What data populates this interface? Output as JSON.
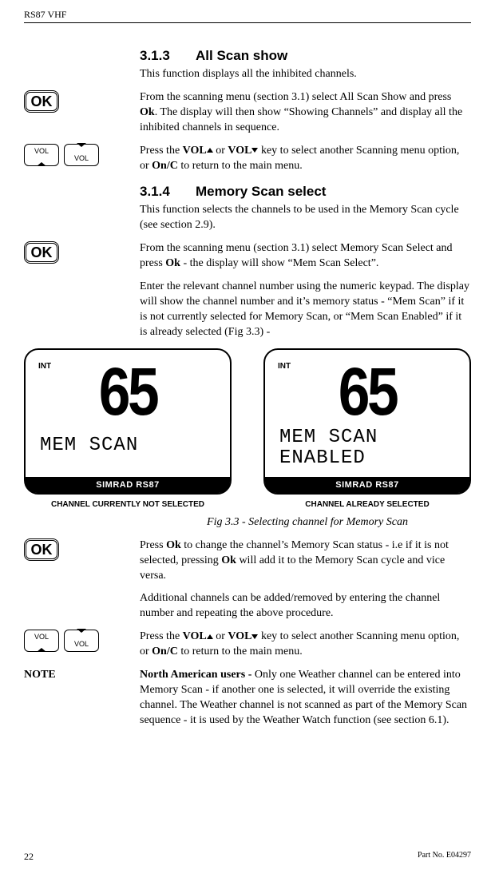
{
  "header": {
    "title": "RS87 VHF"
  },
  "s313": {
    "num": "3.1.3",
    "title": "All Scan show",
    "intro": "This function displays all the inhibited channels.",
    "p1a": "From the scanning menu (section 3.1) select All Scan Show and press ",
    "p1b": ".  The display will then show “Showing Channels” and display all the inhibited channels in sequence.",
    "ok": "Ok",
    "p2a": "Press the ",
    "vol": "VOL",
    "p2b": " or ",
    "p2c": " key to select another Scanning menu option, or ",
    "onc": "On/C",
    "p2d": " to return to the main menu."
  },
  "s314": {
    "num": "3.1.4",
    "title": "Memory Scan select",
    "intro": "This function selects the channels to be used in the Memory Scan cycle (see section 2.9).",
    "p1a": "From the scanning menu (section 3.1) select Memory Scan Select and press ",
    "ok": "Ok",
    "p1b": " - the display will show “Mem Scan Select”.",
    "p2": "Enter the relevant channel number using the numeric keypad.  The display will show the channel number and it’s memory status - “Mem Scan” if it is not currently selected for Memory Scan, or “Mem Scan Enabled” if it is already selected (Fig 3.3) -"
  },
  "lcd": {
    "int": "INT",
    "channel": "65",
    "line1": "MEM SCAN",
    "line2": "ENABLED",
    "brand": "SIMRAD RS87",
    "cap1": "CHANNEL CURRENTLY NOT SELECTED",
    "cap2": "CHANNEL ALREADY SELECTED"
  },
  "fig": "Fig 3.3 - Selecting channel for Memory Scan",
  "after": {
    "p1a": "Press ",
    "ok": "Ok",
    "p1b": " to change the channel’s Memory Scan status - i.e if it is not selected, pressing ",
    "p1c": " will add it to  the Memory Scan cycle and vice versa.",
    "p2": "Additional channels can be added/removed by entering the channel number and repeating the above procedure.",
    "p3a": "Press the ",
    "vol": "VOL",
    "p3b": " or ",
    "p3c": " key to select another Scanning menu option, or ",
    "onc": "On/C",
    "p3d": " to return to the main menu."
  },
  "note": {
    "label": "NOTE",
    "bold": "North American users - ",
    "text": "Only one Weather channel can be entered into Memory Scan - if another one is selected, it will override the existing channel.   The Weather channel is not scanned as part of the Memory Scan sequence - it is used by the Weather Watch function (see section 6.1)."
  },
  "footer": {
    "page": "22",
    "part": "Part No. E04297"
  },
  "buttons": {
    "ok": "OK",
    "vol": "VOL"
  }
}
